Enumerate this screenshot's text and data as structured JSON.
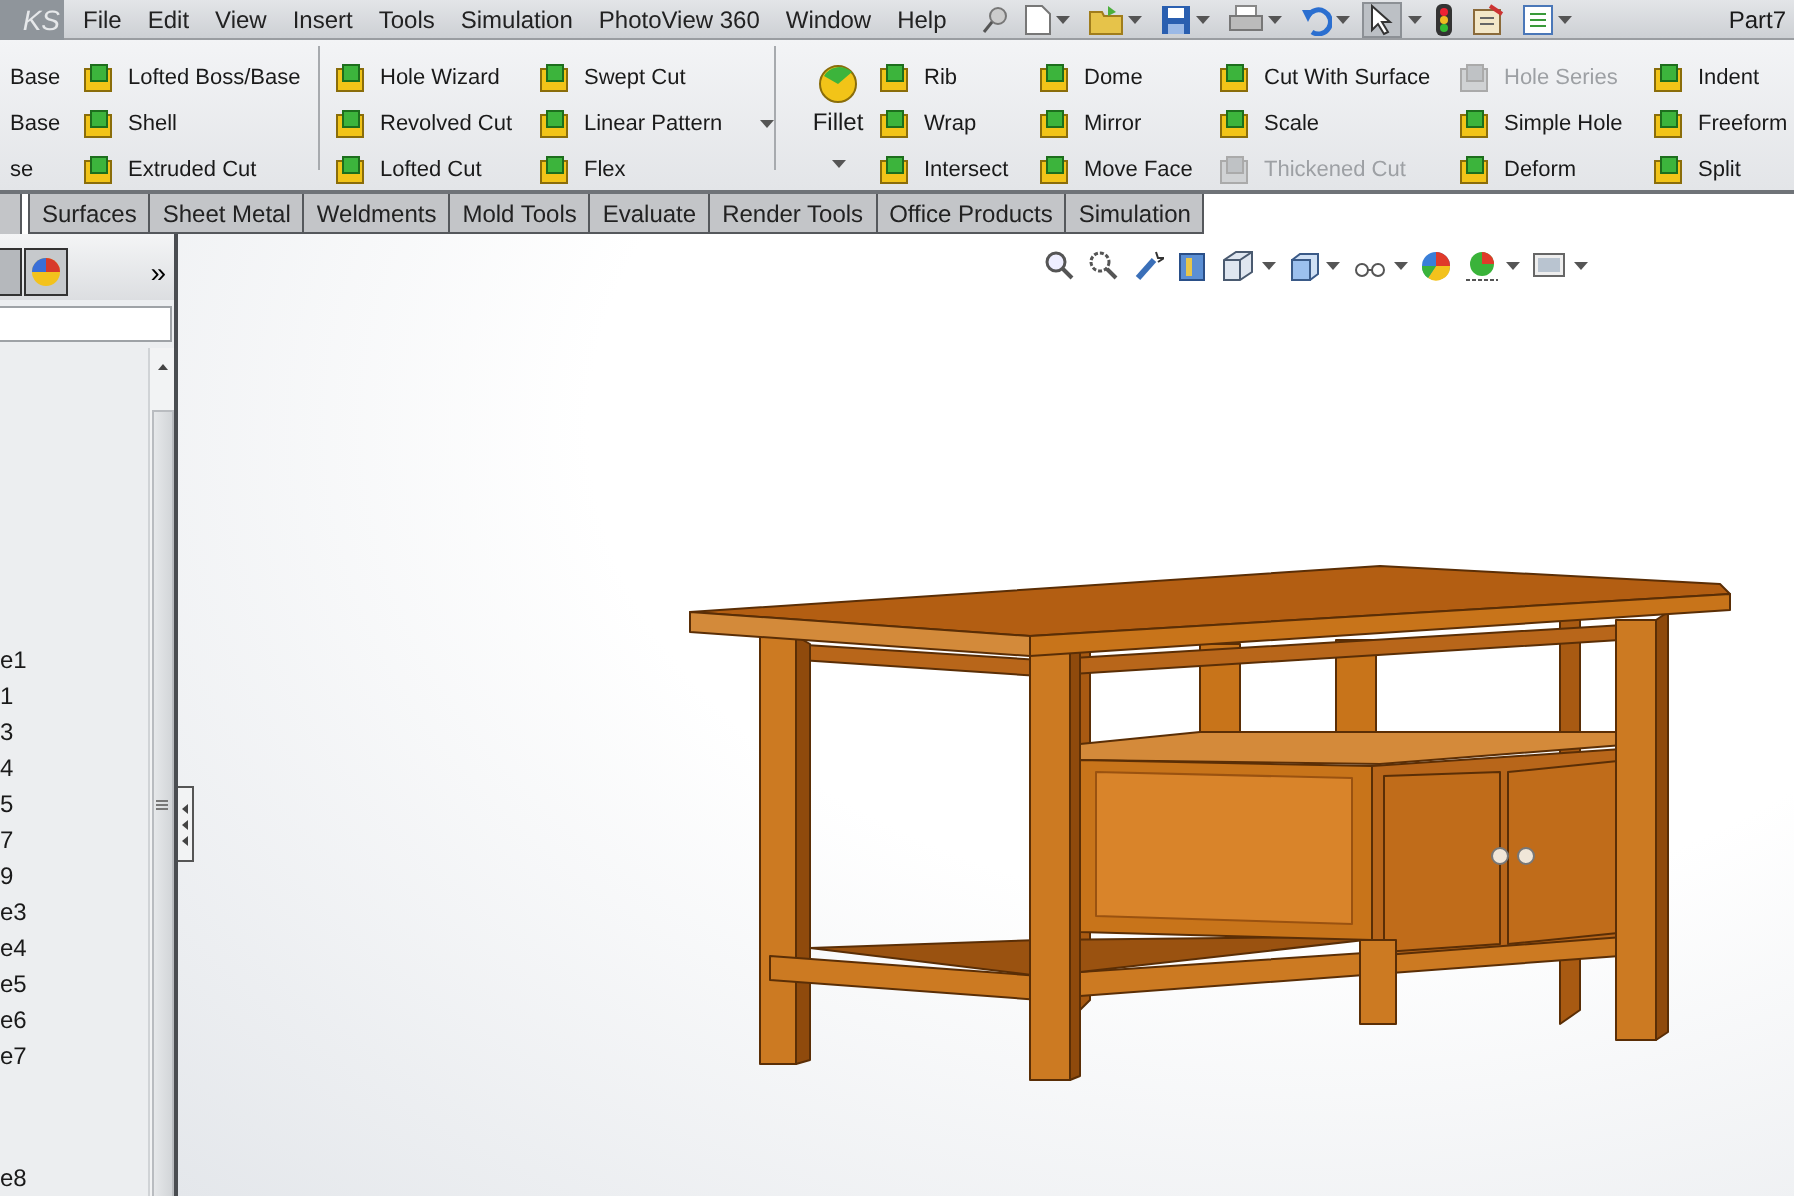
{
  "menubar": {
    "logo": "KS",
    "items": [
      "File",
      "Edit",
      "View",
      "Insert",
      "Tools",
      "Simulation",
      "PhotoView 360",
      "Window",
      "Help"
    ],
    "document_title": "Part7"
  },
  "ribbon": {
    "groups": [
      {
        "columns": [
          {
            "kind": "partial",
            "items": [
              {
                "label": "Base",
                "disabled": false,
                "dropdown": false
              },
              {
                "label": "Base",
                "disabled": false,
                "dropdown": false
              },
              {
                "label": "se",
                "disabled": false,
                "dropdown": false
              }
            ]
          },
          {
            "kind": "stack",
            "items": [
              {
                "label": "Lofted Boss/Base",
                "disabled": false,
                "dropdown": false
              },
              {
                "label": "Shell",
                "disabled": false,
                "dropdown": false
              },
              {
                "label": "Extruded Cut",
                "disabled": false,
                "dropdown": false
              }
            ]
          }
        ]
      },
      {
        "columns": [
          {
            "kind": "stack",
            "items": [
              {
                "label": "Hole Wizard",
                "disabled": false,
                "dropdown": false
              },
              {
                "label": "Revolved Cut",
                "disabled": false,
                "dropdown": false
              },
              {
                "label": "Lofted Cut",
                "disabled": false,
                "dropdown": false
              }
            ]
          },
          {
            "kind": "stack",
            "items": [
              {
                "label": "Swept Cut",
                "disabled": false,
                "dropdown": false
              },
              {
                "label": "Linear Pattern",
                "disabled": false,
                "dropdown": true
              },
              {
                "label": "Flex",
                "disabled": false,
                "dropdown": false
              }
            ]
          }
        ]
      },
      {
        "columns": [
          {
            "kind": "large",
            "items": [
              {
                "label": "Fillet",
                "disabled": false,
                "dropdown": true
              }
            ]
          },
          {
            "kind": "stack",
            "items": [
              {
                "label": "Rib",
                "disabled": false,
                "dropdown": false
              },
              {
                "label": "Wrap",
                "disabled": false,
                "dropdown": false
              },
              {
                "label": "Intersect",
                "disabled": false,
                "dropdown": false
              }
            ]
          },
          {
            "kind": "stack",
            "items": [
              {
                "label": "Dome",
                "disabled": false,
                "dropdown": false
              },
              {
                "label": "Mirror",
                "disabled": false,
                "dropdown": false
              },
              {
                "label": "Move Face",
                "disabled": false,
                "dropdown": false
              }
            ]
          },
          {
            "kind": "stack",
            "items": [
              {
                "label": "Cut With Surface",
                "disabled": false,
                "dropdown": false
              },
              {
                "label": "Scale",
                "disabled": false,
                "dropdown": false
              },
              {
                "label": "Thickened Cut",
                "disabled": true,
                "dropdown": false
              }
            ]
          },
          {
            "kind": "stack",
            "items": [
              {
                "label": "Hole Series",
                "disabled": true,
                "dropdown": false
              },
              {
                "label": "Simple Hole",
                "disabled": false,
                "dropdown": false
              },
              {
                "label": "Deform",
                "disabled": false,
                "dropdown": false
              }
            ]
          },
          {
            "kind": "stack",
            "items": [
              {
                "label": "Indent",
                "disabled": false,
                "dropdown": false
              },
              {
                "label": "Freeform",
                "disabled": false,
                "dropdown": false
              },
              {
                "label": "Split",
                "disabled": false,
                "dropdown": false
              }
            ]
          }
        ]
      }
    ]
  },
  "tabs": [
    {
      "label": "Surfaces",
      "selected": false
    },
    {
      "label": "Sheet Metal",
      "selected": false
    },
    {
      "label": "Weldments",
      "selected": false
    },
    {
      "label": "Mold Tools",
      "selected": false
    },
    {
      "label": "Evaluate",
      "selected": false
    },
    {
      "label": "Render Tools",
      "selected": false
    },
    {
      "label": "Office Products",
      "selected": false
    },
    {
      "label": "Simulation",
      "selected": false
    }
  ],
  "panel": {
    "overflow_button": "»",
    "rows": [
      "e1",
      "1",
      "3",
      "4",
      "5",
      "7",
      "9",
      "e3",
      "e4",
      "e5",
      "e6",
      "e7"
    ],
    "last_row": "e8"
  }
}
